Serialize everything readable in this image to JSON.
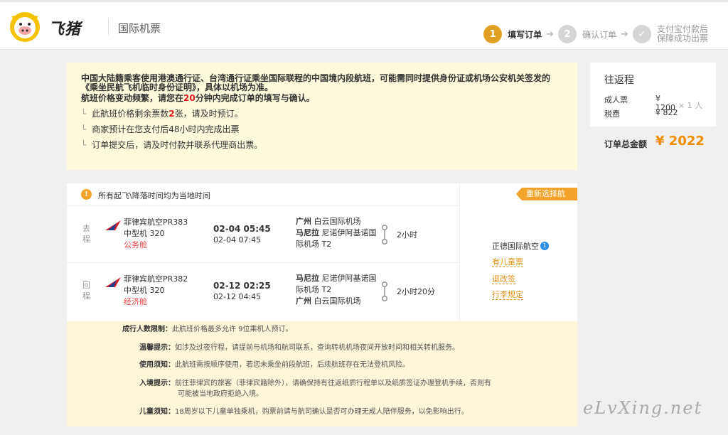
{
  "header": {
    "logo_text": "飞猪",
    "title": "国际机票",
    "steps": [
      {
        "num": "1",
        "label": "填写订单"
      },
      {
        "num": "2",
        "label": "确认订单"
      },
      {
        "num": "✓",
        "label_line1": "支付宝付款后",
        "label_line2": "保障成功出票"
      }
    ]
  },
  "notice": {
    "line1": "中国大陆籍乘客使用港澳通行证、台湾通行证乘坐国际联程的中国境内段航班，可能需同时提供身份证或机场公安机关签发的《乘坐民航飞机临时身份证明》，具体以机场为准。",
    "line2_pre": "航班价格变动频繁，请您在",
    "line2_num": "20",
    "line2_post": "分钟内完成订单的填写与确认。",
    "items": [
      {
        "pre": "此航班价格剩余票数",
        "num": "2",
        "post": "张，请及时预订。"
      },
      {
        "pre": "商家预计在您支付后48小时内完成出票",
        "num": "",
        "post": ""
      },
      {
        "pre": "订单提交后，请及时付款并联系代理商出票。",
        "num": "",
        "post": ""
      }
    ]
  },
  "summary": {
    "title": "往返程",
    "adult_label": "成人票",
    "adult_price": "¥ 1200",
    "tax_label": "税费",
    "tax_price": "¥ 822",
    "qty": "× 1 人",
    "total_label": "订单总金额",
    "total_value": "¥ 2022"
  },
  "flight": {
    "tz_note": "所有起飞\\降落时间均为当地时间",
    "reselect": "重新选择航班",
    "agent": "正德国际航空",
    "agent_badge": "1",
    "links": [
      "有儿童票",
      "退改签",
      "行李规定"
    ],
    "legs": [
      {
        "dir1": "去",
        "dir2": "程",
        "airline": "菲律宾航空PR383",
        "aircraft": "中型机 320",
        "cabin": "公务舱",
        "dep_time": "02-04 05:45",
        "arr_time": "02-04 07:45",
        "from_city": "广州",
        "from_airport": "白云国际机场",
        "to_city": "马尼拉",
        "to_airport_a": "尼诺伊阿基诺国",
        "to_airport_b": "际机场 T2",
        "duration": "2小时"
      },
      {
        "dir1": "回",
        "dir2": "程",
        "airline": "菲律宾航空PR382",
        "aircraft": "中型机 320",
        "cabin": "经济舱",
        "dep_time": "02-12 02:25",
        "arr_time": "02-12 04:45",
        "from_city": "马尼拉",
        "from_airport_a": "尼诺伊阿基诺国",
        "from_airport_b": "际机场 T2",
        "to_city": "广州",
        "to_airport": "白云国际机场",
        "duration": "2小时20分"
      }
    ]
  },
  "rules": [
    {
      "key": "成行人数限制：",
      "text": "此航班价格最多允许 9位乘机人预订。"
    },
    {
      "key": "温馨提示：",
      "text": "如涉及过夜行程，请提前与机场和航司联系，查询转机机场夜间开放时间和相关转机服务。"
    },
    {
      "key": "使用须知：",
      "text": "此航班需按顺序使用，若您未乘坐前段航班，后续航班存在无法登机风险。"
    },
    {
      "key": "入境提示：",
      "text": "前往菲律宾的旅客（菲律宾籍除外），请确保持有往返纸质行程单以及纸质签证办理登机手续，否则有",
      "text2": "可能被当地政府拒绝入境。"
    },
    {
      "key": "儿童须知：",
      "text": "18周岁以下儿童单独乘机，购票前请与航司确认是否可办理无成人陪伴服务，以免影响出行。"
    }
  ],
  "watermark": "eLvXing.net",
  "colors": {
    "brand": "#f3a32a",
    "price": "#f08c00",
    "danger": "#e0161b",
    "notice_bg": "#fdfbdb"
  }
}
